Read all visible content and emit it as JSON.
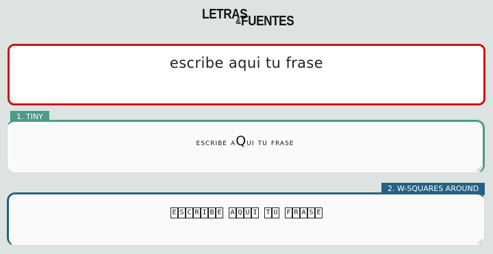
{
  "logo": {
    "word1": "LETRAS",
    "amp": "&",
    "word2": "FUENTES"
  },
  "input": {
    "text": "escribe aqui tu frase"
  },
  "styles": [
    {
      "label": "1. TINY",
      "preview_parts": [
        "escribe a",
        "Q",
        "ui tu frase"
      ],
      "accent": "#4c9a87"
    },
    {
      "label": "2. W-SQUARES AROUND",
      "preview_words": [
        "ESCRIBE",
        "AQUI",
        "TU",
        "FRASE"
      ],
      "accent": "#256182"
    }
  ],
  "colors": {
    "background": "#dde3e0",
    "input_border": "#cc1111"
  }
}
